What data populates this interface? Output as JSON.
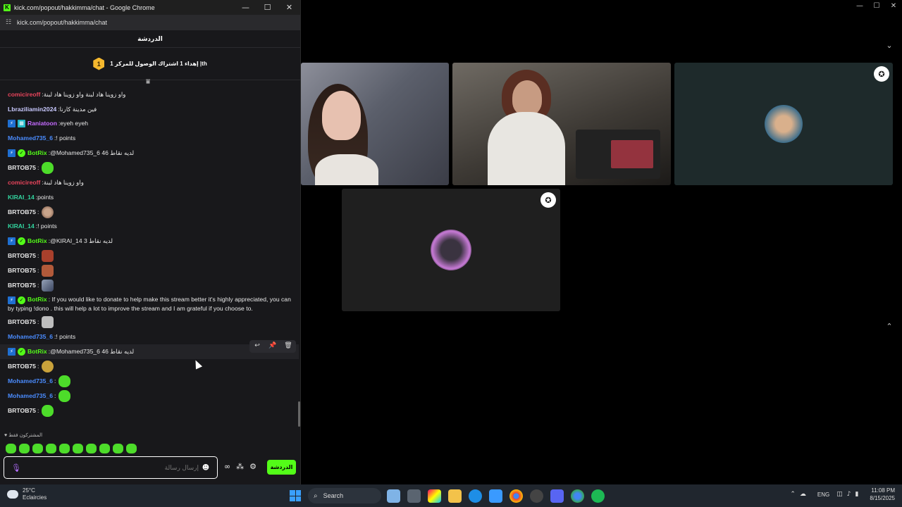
{
  "browser": {
    "title": "kick.com/popout/hakkimma/chat - Google Chrome",
    "url": "kick.com/popout/hakkimma/chat"
  },
  "chat": {
    "header": "الدردشة",
    "goal_badge": "1",
    "goal_text": "إهداء 1 اشتراك الوصول للمركز 1 |th",
    "messages": [
      {
        "user": "comicireoff",
        "color": "#e8445b",
        "text": "واو زوينا هاد لبنة واو زوينا هاد لبنة",
        "badges": []
      },
      {
        "user": "Lbraziliamin2024",
        "color": "#c9c9ff",
        "text": "فين مدينة كارنا",
        "badges": []
      },
      {
        "user": "Raniatoon",
        "color": "#c56bff",
        "text": "eyeh eyeh",
        "badges": [
          "b",
          "t"
        ]
      },
      {
        "user": "Mohamed735_6",
        "color": "#4a8cff",
        "text": "! points",
        "badges": []
      },
      {
        "user": "BotRix",
        "color": "#53fc18",
        "text": "@Mohamed735_6 46 لديه نقاط",
        "badges": [
          "b",
          "v"
        ]
      },
      {
        "user": "BRTOB75",
        "color": "#e8e8e8",
        "text": "",
        "emote": "green",
        "badges": []
      },
      {
        "user": "comicireoff",
        "color": "#e8445b",
        "text": "واو زوينا هاد لبنة",
        "badges": []
      },
      {
        "user": "KIRAI_14",
        "color": "#32d6a0",
        "text": "points",
        "badges": []
      },
      {
        "user": "BRTOB75",
        "color": "#e8e8e8",
        "text": "",
        "emote": "face",
        "badges": []
      },
      {
        "user": "KIRAI_14",
        "color": "#32d6a0",
        "text": "! points",
        "badges": []
      },
      {
        "user": "BotRix",
        "color": "#53fc18",
        "text": "@KIRAI_14 3 لديه نقاط",
        "badges": [
          "b",
          "v"
        ]
      },
      {
        "user": "BRTOB75",
        "color": "#e8e8e8",
        "text": "",
        "emote": "red",
        "badges": []
      },
      {
        "user": "BRTOB75",
        "color": "#e8e8e8",
        "text": "",
        "emote": "red2",
        "badges": []
      },
      {
        "user": "BRTOB75",
        "color": "#e8e8e8",
        "text": "",
        "emote": "shark",
        "badges": []
      },
      {
        "user": "BotRix",
        "color": "#53fc18",
        "text": "If you would like to donate to help make this stream better it's highly appreciated, you can by typing !dono . this will help a lot to improve the stream and I am grateful if you choose to.",
        "badges": [
          "b",
          "v"
        ],
        "multi": true
      },
      {
        "user": "BRTOB75",
        "color": "#e8e8e8",
        "text": "",
        "emote": "cat",
        "badges": []
      },
      {
        "user": "Mohamed735_6",
        "color": "#4a8cff",
        "text": "! points",
        "badges": []
      },
      {
        "user": "BotRix",
        "color": "#53fc18",
        "text": "@Mohamed735_6 46 لديه نقاط",
        "badges": [
          "b",
          "v"
        ],
        "highlight": true
      },
      {
        "user": "BRTOB75",
        "color": "#e8e8e8",
        "text": "",
        "emote": "duck",
        "badges": []
      },
      {
        "user": "Mohamed735_6",
        "color": "#4a8cff",
        "text": "",
        "emote": "green",
        "badges": []
      },
      {
        "user": "Mohamed735_6",
        "color": "#4a8cff",
        "text": "",
        "emote": "green",
        "badges": []
      },
      {
        "user": "BRTOB75",
        "color": "#e8e8e8",
        "text": "",
        "emote": "green",
        "badges": []
      }
    ],
    "subs_label": "المشتركون فقط",
    "input_placeholder": "إرسال رسالة",
    "send_label": "الدردشة"
  },
  "taskbar": {
    "weather_temp": "25°C",
    "weather_desc": "Eclaircies",
    "search_label": "Search",
    "lang": "ENG",
    "time": "11:08 PM",
    "date": "8/15/2025"
  },
  "colors": {
    "kick_green": "#53fc18",
    "chat_bg": "#18181b"
  }
}
